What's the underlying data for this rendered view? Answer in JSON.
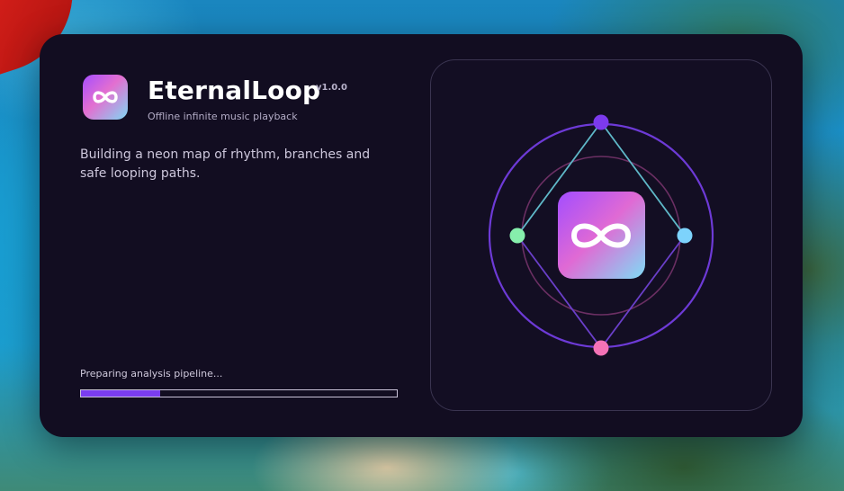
{
  "app": {
    "name": "EternalLoop",
    "version": "v1.0.0",
    "tagline": "Offline infinite music playback",
    "description": "Building a neon map of rhythm, branches and safe looping paths.",
    "logo_icon": "infinity-icon"
  },
  "loading": {
    "status": "Preparing analysis pipeline...",
    "progress": 0.25
  },
  "colors": {
    "window_bg": "#120d21",
    "accent": "#7a3df0",
    "node_top": "#7c3aed",
    "node_left": "#86efac",
    "node_right": "#7dd3fc",
    "node_bottom": "#f472b6",
    "outer_ring": "#6d3ad6",
    "inner_ring": "#6b2f63",
    "edge_cyan": "#5fb8c8",
    "edge_purple": "#6a3fc9"
  }
}
